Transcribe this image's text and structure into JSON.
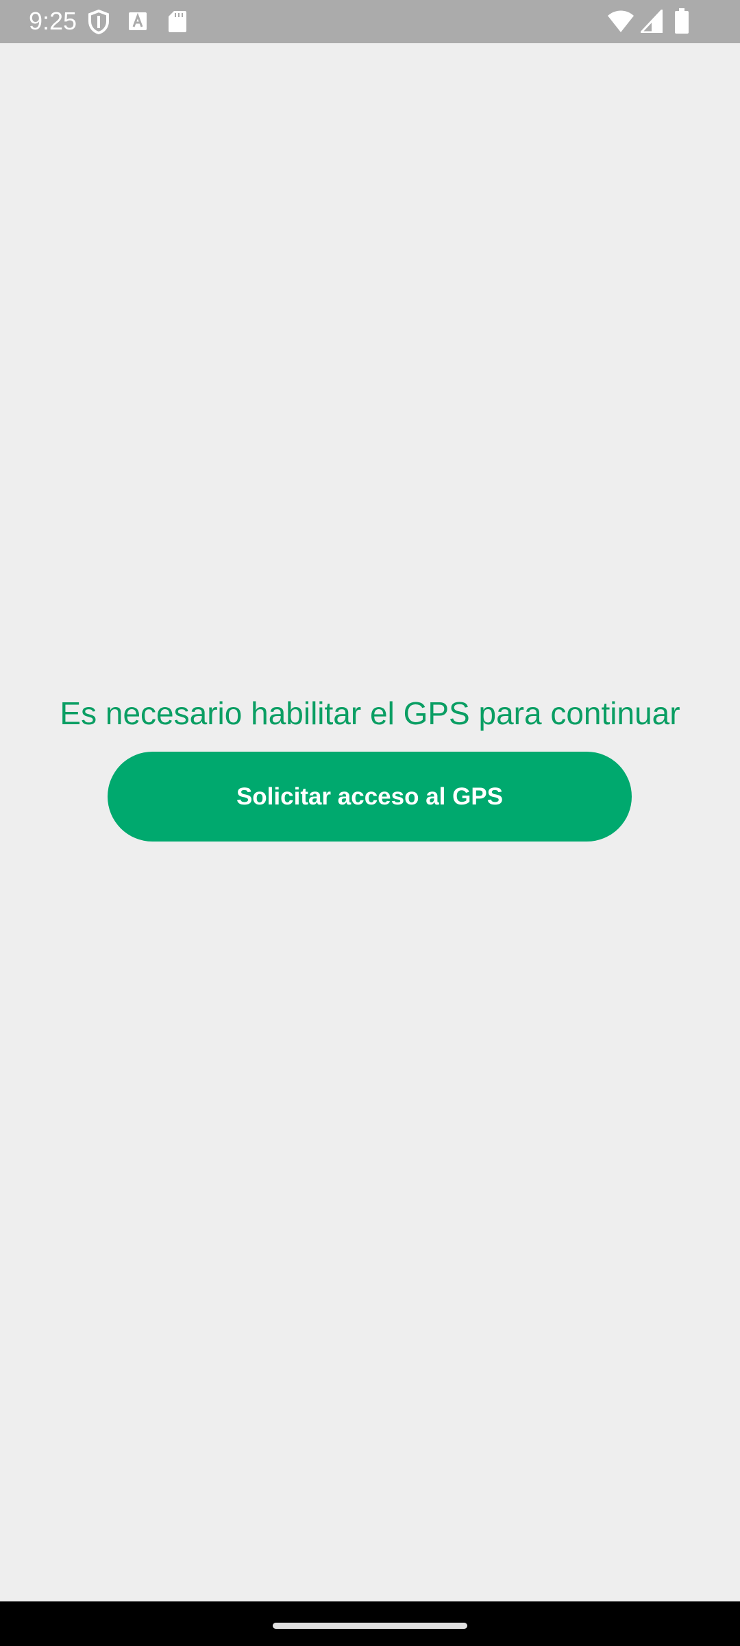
{
  "status_bar": {
    "time": "9:25",
    "icons_left": [
      "shield-icon",
      "text-a-icon",
      "sd-card-icon"
    ],
    "icons_right": [
      "wifi-icon",
      "signal-icon",
      "battery-icon"
    ]
  },
  "main": {
    "message": "Es necesario habilitar el GPS para continuar",
    "button_label": "Solicitar acceso al GPS"
  },
  "colors": {
    "accent": "#00a96e",
    "message_text": "#0a9e63",
    "background": "#eeeeee",
    "status_bar": "#ababab"
  }
}
